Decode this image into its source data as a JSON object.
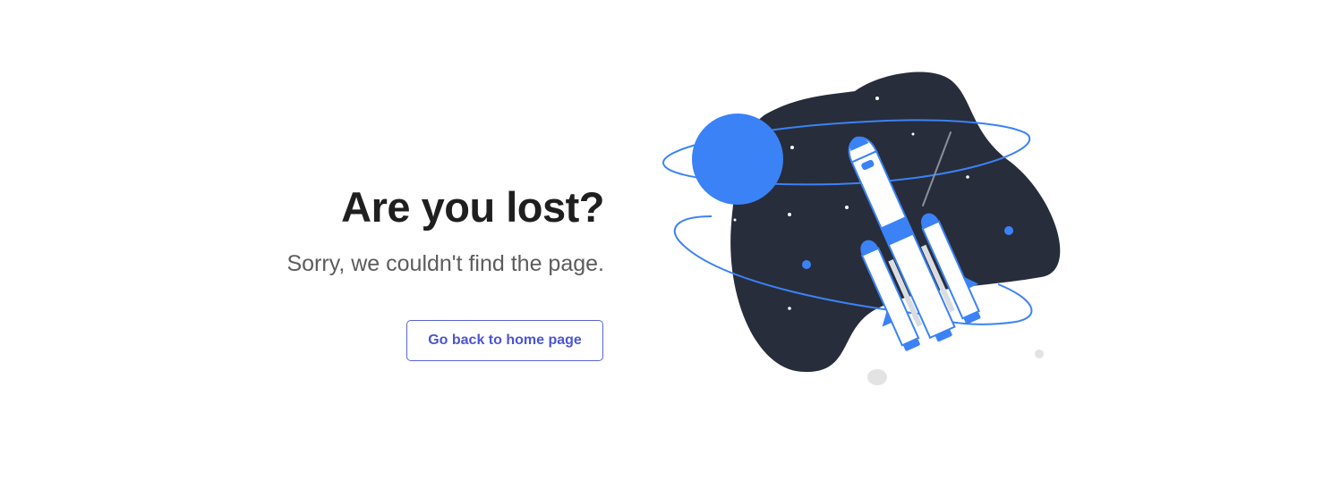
{
  "error_page": {
    "title": "Are you lost?",
    "message": "Sorry, we couldn't find the page.",
    "home_button_label": "Go back to home page"
  },
  "illustration": {
    "subject": "rocket-in-space",
    "colors": {
      "space": "#272d3a",
      "accent": "#3b82f6",
      "rocket_body": "#ffffff",
      "dust": "#e3e3e3"
    }
  },
  "colors": {
    "title": "#1f1f1f",
    "subtitle": "#5c5c5c",
    "button_border": "#5a63d6",
    "button_text": "#4b55d1"
  }
}
